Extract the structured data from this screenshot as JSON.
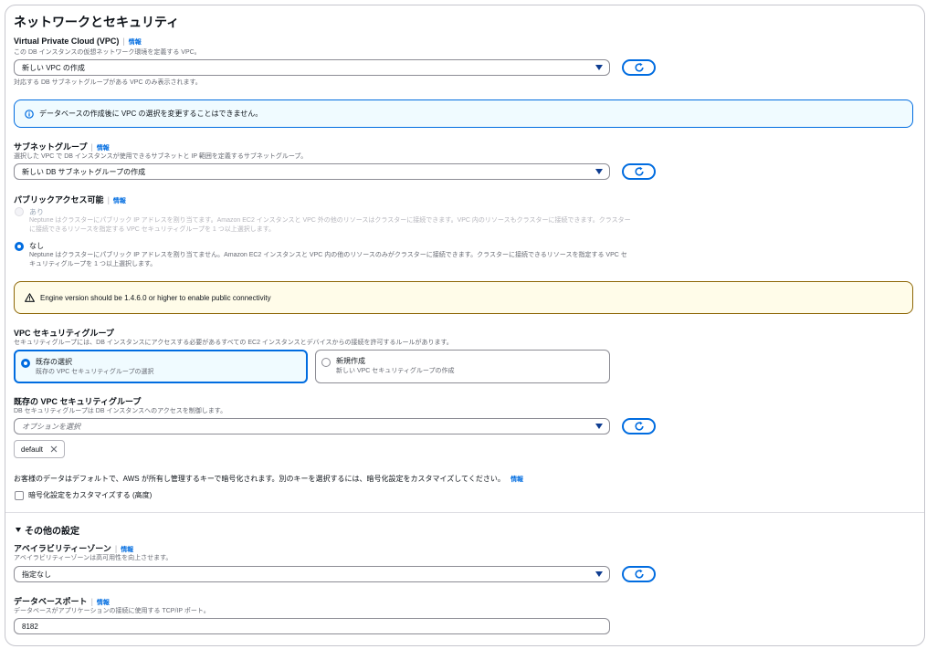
{
  "section": {
    "title": "ネットワークとセキュリティ"
  },
  "info_label": "情報",
  "vpc": {
    "label": "Virtual Private Cloud (VPC)",
    "description": "この DB インスタンスの仮想ネットワーク環境を定義する VPC。",
    "selected": "新しい VPC の作成",
    "hint": "対応する DB サブネットグループがある VPC のみ表示されます。"
  },
  "vpc_alert": {
    "text": "データベースの作成後に VPC の選択を変更することはできません。"
  },
  "subnet": {
    "label": "サブネットグループ",
    "description": "選択した VPC で DB インスタンスが使用できるサブネットと IP 範囲を定義するサブネットグループ。",
    "selected": "新しい DB サブネットグループの作成"
  },
  "public_access": {
    "label": "パブリックアクセス可能",
    "options": [
      {
        "label": "あり",
        "description": "Neptune はクラスターにパブリック IP アドレスを割り当てます。Amazon EC2 インスタンスと VPC 外の他のリソースはクラスターに接続できます。VPC 内のリソースもクラスターに接続できます。クラスターに接続できるリソースを指定する VPC セキュリティグループを 1 つ以上選択します。",
        "checked": false,
        "disabled": true
      },
      {
        "label": "なし",
        "description": "Neptune はクラスターにパブリック IP アドレスを割り当てません。Amazon EC2 インスタンスと VPC 内の他のリソースのみがクラスターに接続できます。クラスターに接続できるリソースを指定する VPC セキュリティグループを 1 つ以上選択します。",
        "checked": true,
        "disabled": false
      }
    ]
  },
  "warning_alert": {
    "text": "Engine version should be 1.4.6.0 or higher to enable public connectivity"
  },
  "security_group": {
    "label": "VPC セキュリティグループ",
    "description": "セキュリティグループには、DB インスタンスにアクセスする必要があるすべての EC2 インスタンスとデバイスからの接続を許可するルールがあります。",
    "tiles": [
      {
        "title": "既存の選択",
        "description": "既存の VPC セキュリティグループの選択",
        "selected": true
      },
      {
        "title": "新規作成",
        "description": "新しい VPC セキュリティグループの作成",
        "selected": false
      }
    ]
  },
  "existing_sg": {
    "label": "既存の VPC セキュリティグループ",
    "description": "DB セキュリティグループは DB インスタンスへのアクセスを制御します。",
    "placeholder": "オプションを選択",
    "tokens": [
      "default"
    ]
  },
  "encryption": {
    "text": "お客様のデータはデフォルトで、AWS が所有し管理するキーで暗号化されます。別のキーを選択するには、暗号化設定をカスタマイズしてください。",
    "checkbox_label": "暗号化設定をカスタマイズする (高度)",
    "checked": false
  },
  "other_settings": {
    "title": "その他の設定",
    "expanded": true
  },
  "az": {
    "label": "アベイラビリティーゾーン",
    "description": "アベイラビリティーゾーンは高可用性を向上させます。",
    "selected": "指定なし"
  },
  "db_port": {
    "label": "データベースポート",
    "description": "データベースがアプリケーションの接続に使用する TCP/IP ポート。",
    "value": "8182"
  },
  "colors": {
    "accent": "#006ce0",
    "info_bg": "#f0fbff",
    "warn_border": "#8d6605",
    "warn_bg": "#fffce9"
  },
  "icons": [
    "refresh-icon",
    "info-circle-icon",
    "warning-icon",
    "close-icon",
    "caret-down-icon"
  ]
}
